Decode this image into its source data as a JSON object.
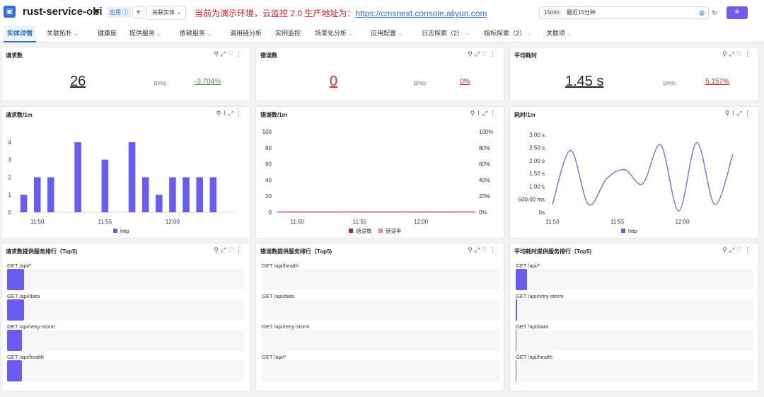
{
  "header": {
    "service_name": "rust-service-obi",
    "app_badge": "应用 ⓘ",
    "related_entity_btn": "关联实体 ⌄",
    "notice_text": "当前为演示环境，云监控 2.0 生产地址为：",
    "notice_link": "https://cmsnext.console.aliyun.com",
    "time_tag": "15min",
    "time_label": "最近15分钟"
  },
  "tabs": [
    {
      "label": "实体详情",
      "chevron": false,
      "active": true
    },
    {
      "label": "关联拓扑",
      "chevron": true
    },
    {
      "label": "健康度",
      "chevron": false
    },
    {
      "label": "提供服务",
      "chevron": true
    },
    {
      "label": "依赖服务",
      "chevron": true
    },
    {
      "label": "调用链分析",
      "chevron": false
    },
    {
      "label": "实例监控",
      "chevron": false
    },
    {
      "label": "场景化分析",
      "chevron": true
    },
    {
      "label": "应用配置",
      "chevron": true
    },
    {
      "label": "日志探索（2）",
      "chevron": true
    },
    {
      "label": "指标探索（2）",
      "chevron": true
    },
    {
      "label": "关联项",
      "chevron": true
    }
  ],
  "stats": {
    "requests": {
      "title": "请求数",
      "value": "26",
      "cmp_label": "日同比:",
      "pct": "-3.704%"
    },
    "errors": {
      "title": "错误数",
      "value": "0",
      "cmp_label": "日同比:",
      "pct": "0%"
    },
    "latency": {
      "title": "平均耗时",
      "value": "1.45 s",
      "cmp_label": "日同比:",
      "pct": "5.157%"
    }
  },
  "chart_titles": {
    "requests": "请求数/1m",
    "errors": "错误数/1m",
    "latency": "耗时/1m"
  },
  "rank_titles": {
    "requests": "请求数提供服务排行（Top5)",
    "errors": "错误数提供服务排行（Top5)",
    "latency": "平均耗时提供服务排行（Top5)"
  },
  "colors": {
    "accent": "#6a5cf2",
    "error_count": "#c0211f",
    "error_rate": "#f07fa0",
    "link": "#2f6fd9",
    "notice": "#d41f1f"
  },
  "chart_data": [
    {
      "type": "bar",
      "categories": [
        "11:49",
        "11:50",
        "11:51",
        "11:52",
        "11:53",
        "11:54",
        "11:55",
        "11:56",
        "11:57",
        "11:58",
        "11:59",
        "12:00",
        "12:01",
        "12:02",
        "12:03",
        "12:04"
      ],
      "x_tick_labels": [
        "11:50",
        "11:55",
        "12:00"
      ],
      "y_tick_labels": [
        "0",
        "1",
        "2",
        "3",
        "4"
      ],
      "series": [
        {
          "name": "http",
          "values": [
            1,
            2,
            2,
            0,
            4,
            0,
            3,
            0,
            4,
            2,
            1,
            2,
            2,
            2,
            2,
            0
          ]
        }
      ],
      "ylim": [
        0,
        4.6
      ]
    },
    {
      "type": "line",
      "x_tick_labels": [
        "11:50",
        "11:55",
        "12:00"
      ],
      "y_tick_labels_left": [
        "0",
        "20",
        "40",
        "60",
        "80",
        "100"
      ],
      "y_tick_labels_right": [
        "0%",
        "20%",
        "40%",
        "60%",
        "80%",
        "100%"
      ],
      "series": [
        {
          "name": "错误数",
          "values": [
            0,
            0,
            0,
            0,
            0,
            0,
            0,
            0,
            0,
            0,
            0,
            0,
            0,
            0,
            0,
            0
          ]
        },
        {
          "name": "错误率",
          "values": [
            0,
            0,
            0,
            0,
            0,
            0,
            0,
            0,
            0,
            0,
            0,
            0,
            0,
            0,
            0,
            0
          ]
        }
      ],
      "ylim": [
        0,
        100
      ]
    },
    {
      "type": "line",
      "x_tick_labels": [
        "11:50",
        "11:55",
        "12:00"
      ],
      "y_tick_labels": [
        "0s",
        "500.00 ms",
        "1.00 s",
        "1.50 s",
        "2.00 s",
        "2.50 s",
        "3.00 s"
      ],
      "series": [
        {
          "name": "http",
          "values": [
            0.3,
            2.4,
            0.3,
            1.3,
            1.65,
            1.1,
            2.6,
            0.05,
            2.7,
            0.3,
            2.25
          ]
        }
      ],
      "ylim": [
        0,
        3.2
      ],
      "unit": "s"
    }
  ],
  "rank": {
    "requests": [
      {
        "label": "GET /api/*",
        "value": 7
      },
      {
        "label": "GET /api/data",
        "value": 7
      },
      {
        "label": "GET /api/retry-storm",
        "value": 6
      },
      {
        "label": "GET /api/health",
        "value": 6
      }
    ],
    "errors": [
      {
        "label": "GET /api/health",
        "value": 0
      },
      {
        "label": "GET /api/data",
        "value": 0
      },
      {
        "label": "GET /api/retry-storm",
        "value": 0
      },
      {
        "label": "GET /api/*",
        "value": 0
      }
    ],
    "latency": [
      {
        "label": "GET /api/*",
        "value": 100
      },
      {
        "label": "GET /api/retry-storm",
        "value": 10
      },
      {
        "label": "GET /api/data",
        "value": 3
      },
      {
        "label": "GET /api/health",
        "value": 1
      }
    ]
  }
}
